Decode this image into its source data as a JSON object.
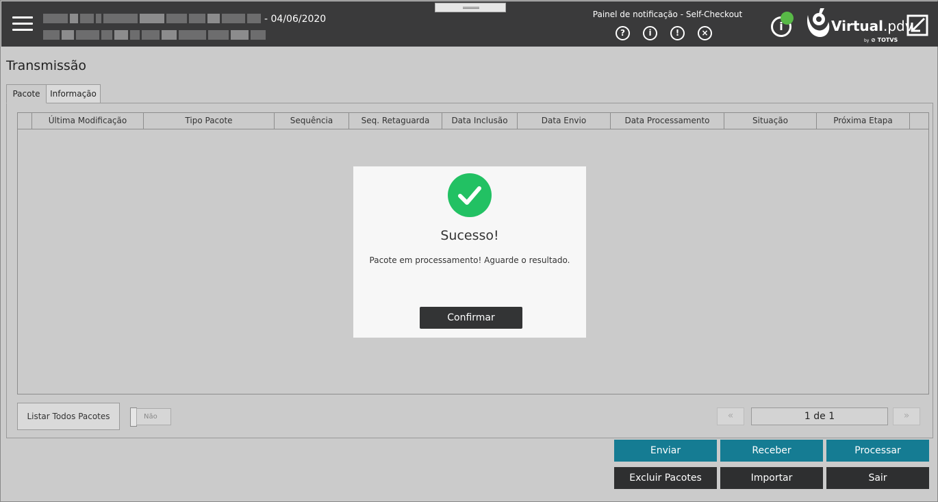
{
  "header": {
    "date_suffix": "- 04/06/2020",
    "notification_title": "Painel de notificação - Self-Checkout",
    "notification_icons": [
      "?",
      "i",
      "!",
      "×"
    ],
    "info_glyph": "i",
    "status_color": "#58b947",
    "logo_main": "Virtual",
    "logo_suffix": ".pdv",
    "logo_by": "by",
    "logo_sub": "TOTVS"
  },
  "page": {
    "title": "Transmissão",
    "tabs": [
      "Pacote",
      "Informação"
    ]
  },
  "table": {
    "columns": [
      "Última Modificação",
      "Tipo Pacote",
      "Sequência",
      "Seq. Retaguarda",
      "Data Inclusão",
      "Data Envio",
      "Data Processamento",
      "Situação",
      "Próxima Etapa"
    ]
  },
  "controls": {
    "list_all": "Listar Todos Pacotes",
    "toggle_label": "Não",
    "prev": "«",
    "next": "»",
    "page_label": "1 de 1"
  },
  "actions": {
    "send": "Enviar",
    "receive": "Receber",
    "process": "Processar",
    "delete": "Excluir Pacotes",
    "import": "Importar",
    "exit": "Sair"
  },
  "dialog": {
    "title": "Sucesso!",
    "message": "Pacote em processamento! Aguarde o resultado.",
    "confirm": "Confirmar"
  },
  "colors": {
    "header_bg": "#3a3a3b",
    "teal": "#157c93",
    "dark": "#2e2f30",
    "success": "#22c163"
  }
}
